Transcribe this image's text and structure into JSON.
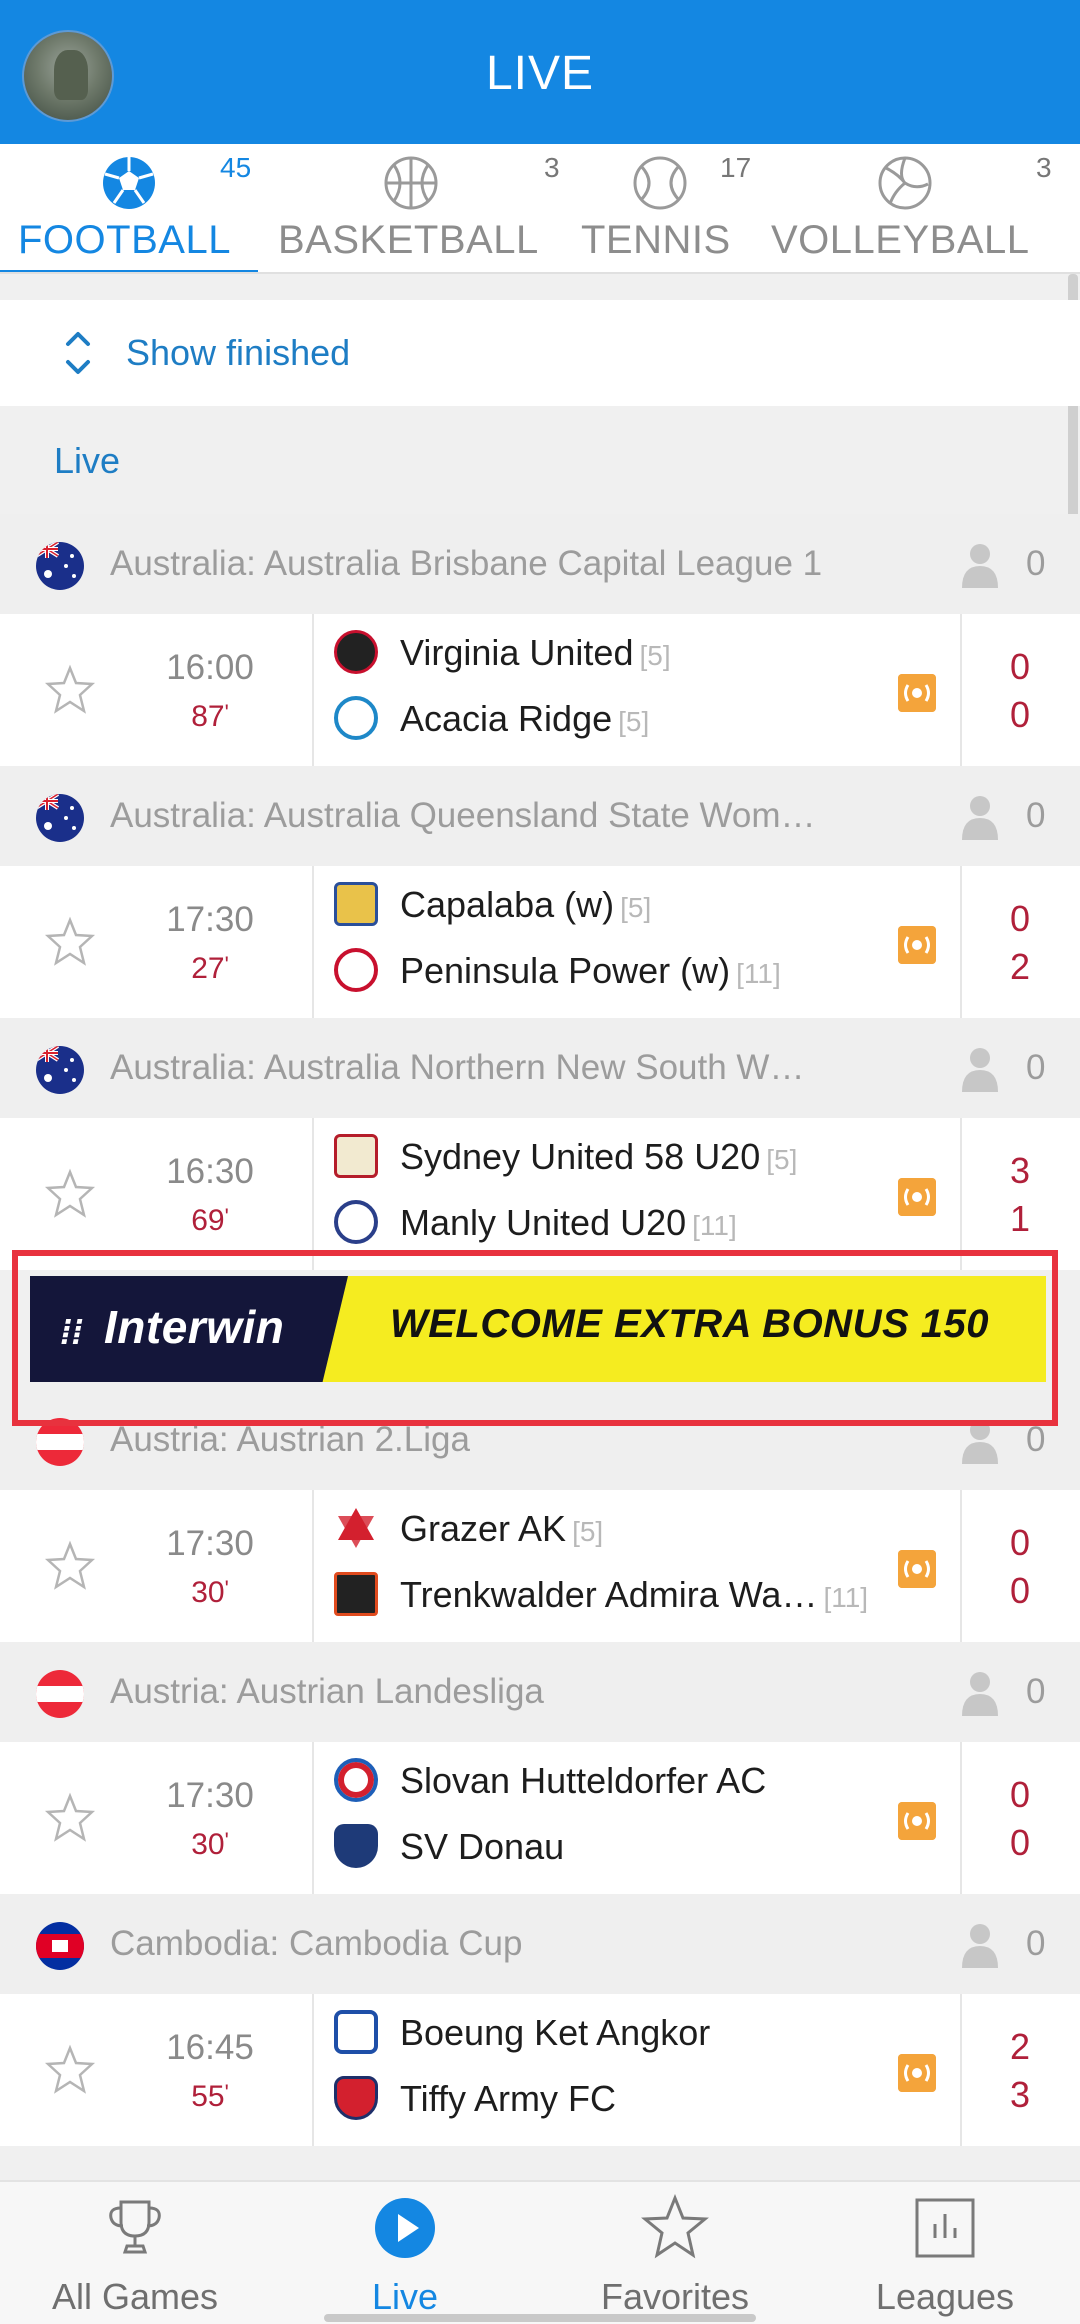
{
  "header": {
    "title": "LIVE"
  },
  "sports_tabs": [
    {
      "label": "FOOTBALL",
      "count": "45",
      "icon": "football-icon",
      "active": true
    },
    {
      "label": "BASKETBALL",
      "count": "3",
      "icon": "basketball-icon"
    },
    {
      "label": "TENNIS",
      "count": "17",
      "icon": "tennis-icon"
    },
    {
      "label": "VOLLEYBALL",
      "count": "3",
      "icon": "volleyball-icon"
    }
  ],
  "show_finished": "Show finished",
  "section_label": "Live",
  "leagues": [
    {
      "name": "Australia: Australia Brisbane Capital League 1",
      "followers": "0",
      "flag": "australia",
      "match": {
        "time": "16:00",
        "minute": "87",
        "home": "Virginia United",
        "home_rank": "[5]",
        "away": "Acacia Ridge",
        "away_rank": "[5]",
        "home_score": "0",
        "away_score": "0"
      }
    },
    {
      "name": "Australia: Australia Queensland State Wom…",
      "followers": "0",
      "flag": "australia",
      "match": {
        "time": "17:30",
        "minute": "27",
        "home": "Capalaba (w)",
        "home_rank": "[5]",
        "away": "Peninsula Power (w)",
        "away_rank": "[11]",
        "home_score": "0",
        "away_score": "2"
      }
    },
    {
      "name": "Australia: Australia Northern New South W…",
      "followers": "0",
      "flag": "australia",
      "match": {
        "time": "16:30",
        "minute": "69",
        "home": "Sydney United 58 U20",
        "home_rank": "[5]",
        "away": "Manly United U20",
        "away_rank": "[11]",
        "home_score": "3",
        "away_score": "1"
      }
    },
    {
      "name": "Austria: Austrian 2.Liga",
      "followers": "0",
      "flag": "austria",
      "match": {
        "time": "17:30",
        "minute": "30",
        "home": "Grazer AK",
        "home_rank": "[5]",
        "away": "Trenkwalder Admira Wa…",
        "away_rank": "[11]",
        "home_score": "0",
        "away_score": "0"
      }
    },
    {
      "name": "Austria: Austrian Landesliga",
      "followers": "0",
      "flag": "austria",
      "match": {
        "time": "17:30",
        "minute": "30",
        "home": "Slovan Hutteldorfer AC",
        "home_rank": "",
        "away": "SV Donau",
        "away_rank": "",
        "home_score": "0",
        "away_score": "0"
      }
    },
    {
      "name": "Cambodia: Cambodia Cup",
      "followers": "0",
      "flag": "cambodia",
      "match": {
        "time": "16:45",
        "minute": "55",
        "home": "Boeung Ket Angkor",
        "home_rank": "",
        "away": "Tiffy Army FC",
        "away_rank": "",
        "home_score": "2",
        "away_score": "3"
      }
    }
  ],
  "ad": {
    "brand": "Interwin",
    "text": "WELCOME EXTRA BONUS 150"
  },
  "bottom_nav": [
    {
      "label": "All Games",
      "icon": "trophy-icon"
    },
    {
      "label": "Live",
      "icon": "play-icon",
      "active": true
    },
    {
      "label": "Favorites",
      "icon": "star-icon"
    },
    {
      "label": "Leagues",
      "icon": "chart-icon"
    }
  ],
  "colors": {
    "primary": "#1487e2",
    "score": "#b0203a",
    "ad_yellow": "#f5ec20",
    "ad_dark": "#14163a",
    "ad_border": "#e8323e"
  }
}
